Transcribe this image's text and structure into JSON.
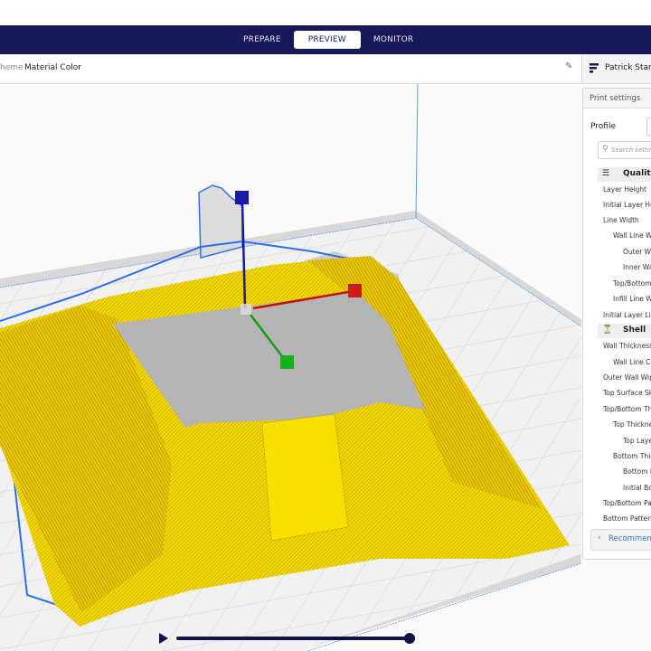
{
  "header": {
    "stages": [
      {
        "label": "PREPARE",
        "active": false
      },
      {
        "label": "PREVIEW",
        "active": true
      },
      {
        "label": "MONITOR",
        "active": false
      }
    ]
  },
  "toolbar": {
    "color_scheme_label": "heme",
    "color_scheme_value": "Material Color",
    "edit_icon": "pencil-icon"
  },
  "printer": {
    "name": "Patrick Stand",
    "icon": "printer-settings-icon"
  },
  "print_settings": {
    "title": "Print settings",
    "profile_label": "Profile",
    "search_placeholder": "Search settings",
    "categories": [
      {
        "label": "Quality",
        "icon": "quality-icon",
        "settings": [
          {
            "label": "Layer Height",
            "indent": 0
          },
          {
            "label": "Initial Layer Height",
            "indent": 0
          },
          {
            "label": "Line Width",
            "indent": 0
          },
          {
            "label": "Wall Line Width",
            "indent": 1
          },
          {
            "label": "Outer Wall Line Width",
            "indent": 2
          },
          {
            "label": "Inner Wall Line Width",
            "indent": 2
          },
          {
            "label": "Top/Bottom Line Width",
            "indent": 1
          },
          {
            "label": "Infill Line Width",
            "indent": 1
          },
          {
            "label": "Initial Layer Line Width",
            "indent": 0
          }
        ]
      },
      {
        "label": "Shell",
        "icon": "shell-icon",
        "settings": [
          {
            "label": "Wall Thickness",
            "indent": 0
          },
          {
            "label": "Wall Line Count",
            "indent": 1
          },
          {
            "label": "Outer Wall Wipe Distance",
            "indent": 0
          },
          {
            "label": "Top Surface Skin Layers",
            "indent": 0
          },
          {
            "label": "Top/Bottom Thickness",
            "indent": 0
          },
          {
            "label": "Top Thickness",
            "indent": 1
          },
          {
            "label": "Top Layers",
            "indent": 2
          },
          {
            "label": "Bottom Thickness",
            "indent": 1
          },
          {
            "label": "Bottom Layers",
            "indent": 2
          },
          {
            "label": "Initial Bottom Layers",
            "indent": 2
          },
          {
            "label": "Top/Bottom Pattern",
            "indent": 0
          },
          {
            "label": "Bottom Pattern Initial Layer",
            "indent": 0
          }
        ]
      }
    ],
    "recommended_label": "Recommended"
  },
  "layer_slider": {
    "play_icon": "play-icon",
    "progress": 1.0
  },
  "viewport": {
    "model_color": "#f2d800",
    "build_volume_outline": "#3b82f6",
    "axis_x_color": "#d01010",
    "axis_y_color": "#10a010",
    "axis_z_color": "#1a1aa8"
  }
}
